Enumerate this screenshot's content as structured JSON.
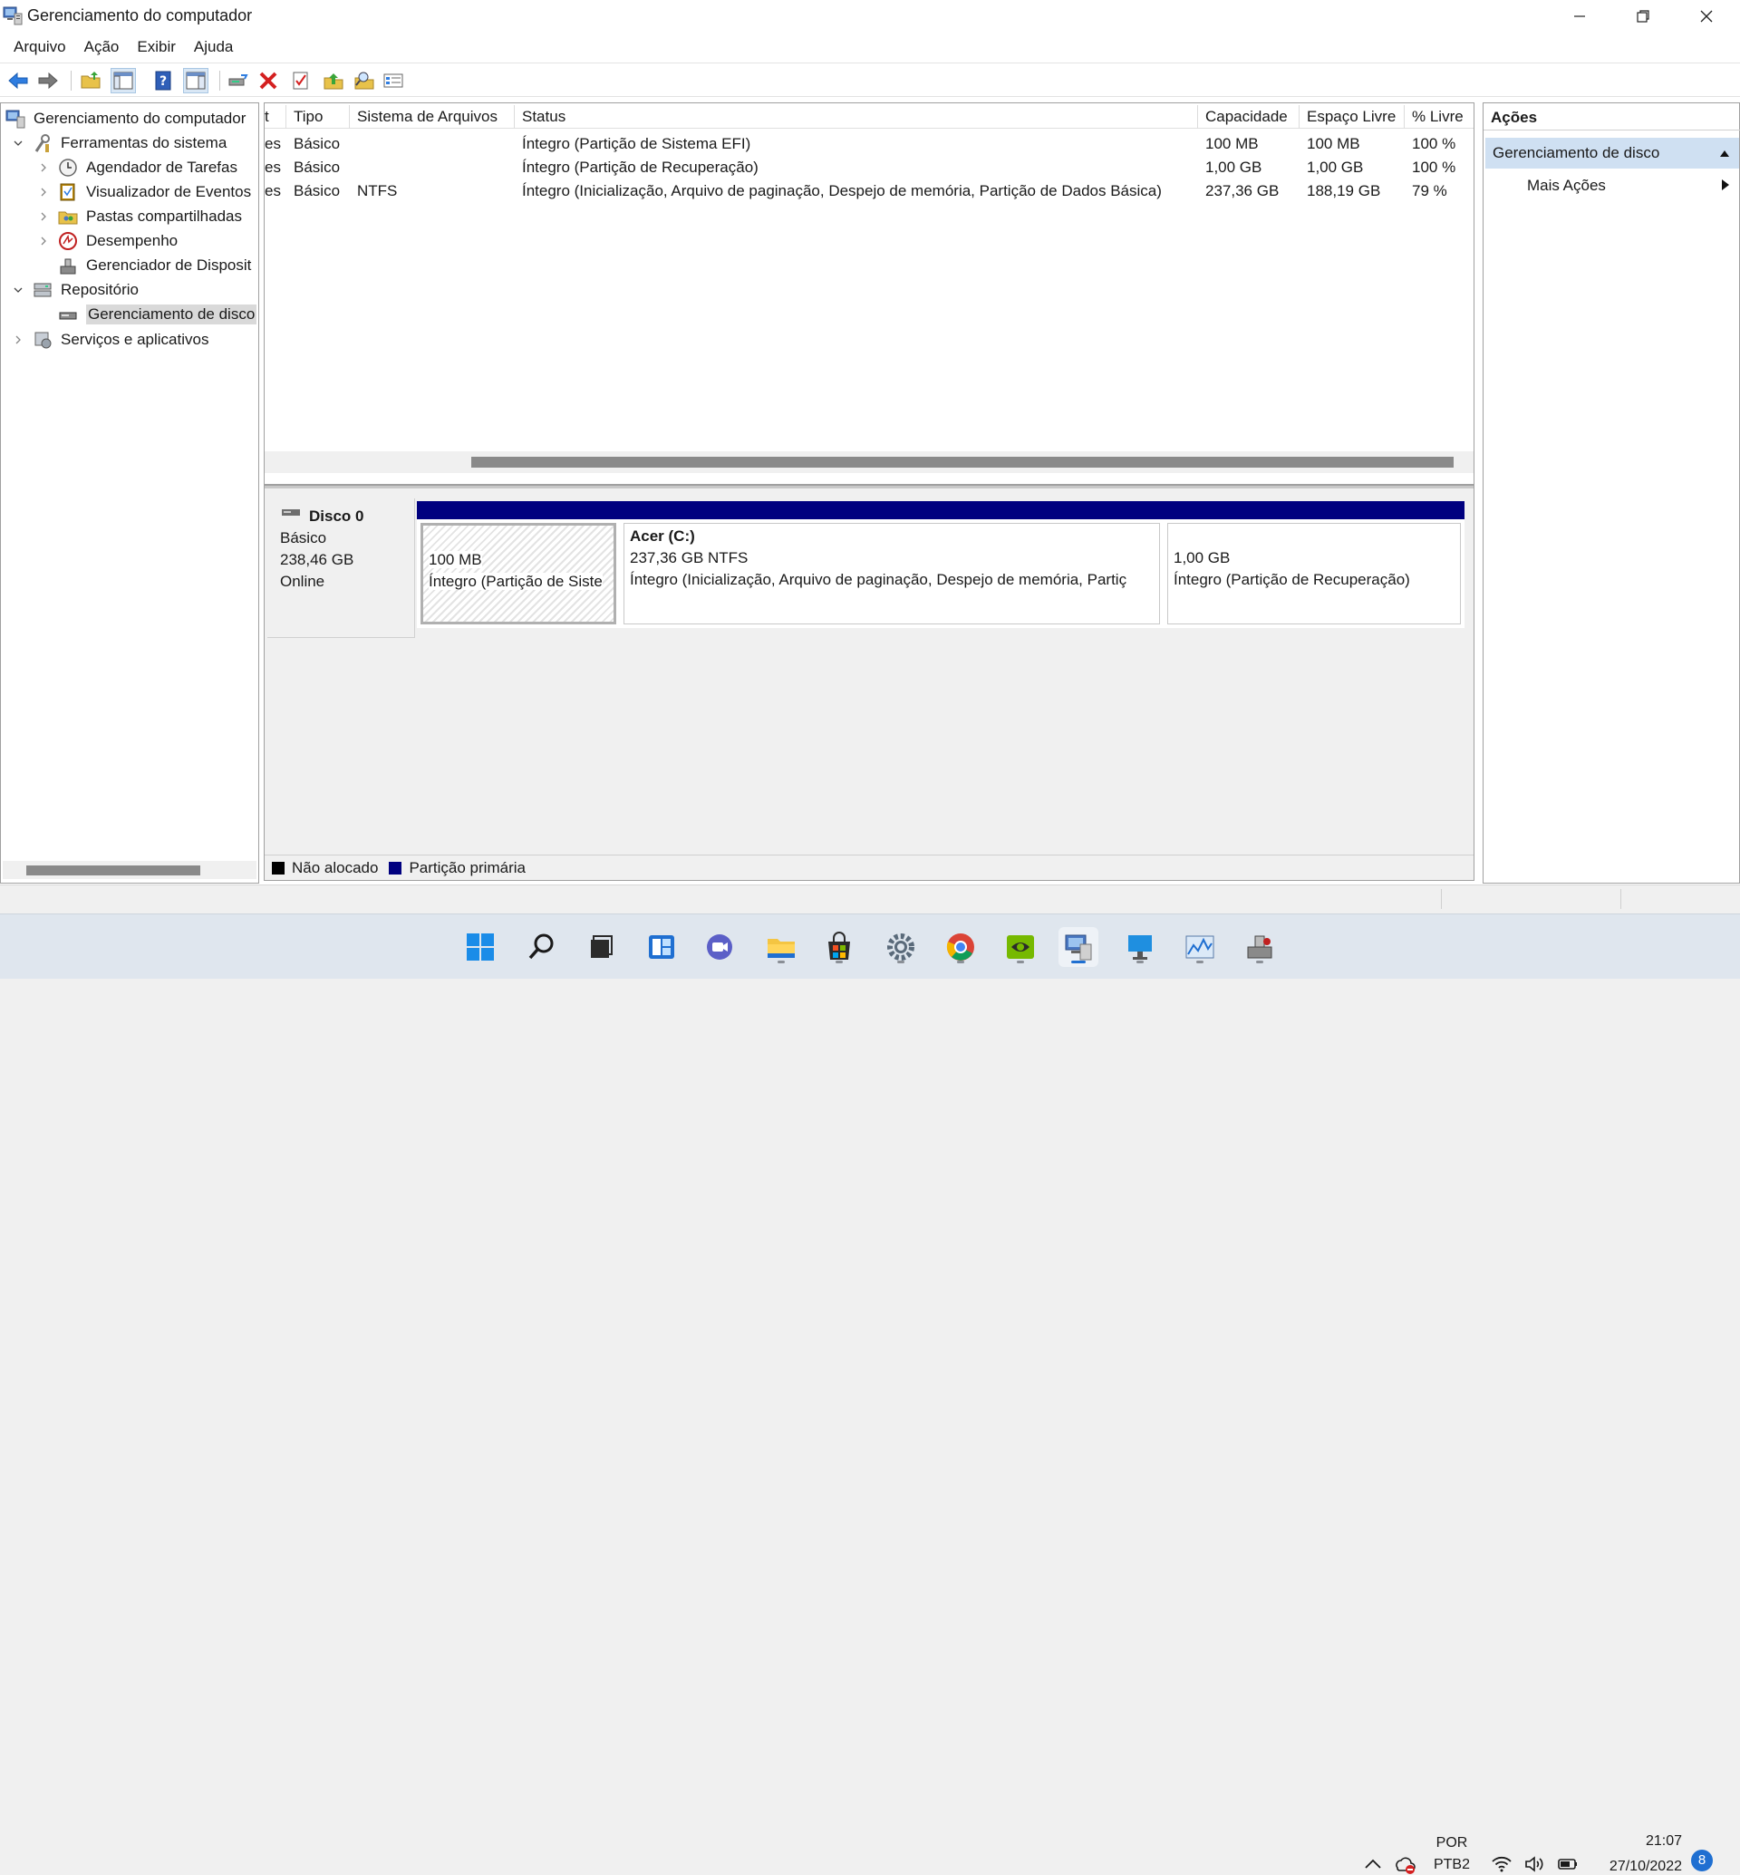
{
  "window": {
    "title": "Gerenciamento do computador"
  },
  "menu": [
    "Arquivo",
    "Ação",
    "Exibir",
    "Ajuda"
  ],
  "tree": {
    "root": "Gerenciamento do computador",
    "system_tools": "Ferramentas do sistema",
    "task_scheduler": "Agendador de Tarefas",
    "event_viewer": "Visualizador de Eventos",
    "shared_folders": "Pastas compartilhadas",
    "performance": "Desempenho",
    "device_manager": "Gerenciador de Disposit",
    "storage": "Repositório",
    "disk_management": "Gerenciamento de disco",
    "services": "Serviços e aplicativos"
  },
  "volumes": {
    "columns": [
      "t",
      "Tipo",
      "Sistema de Arquivos",
      "Status",
      "Capacidade",
      "Espaço Livre",
      "% Livre"
    ],
    "rows": [
      [
        "es",
        "Básico",
        "",
        "Íntegro (Partição de Sistema EFI)",
        "100 MB",
        "100 MB",
        "100 %"
      ],
      [
        "es",
        "Básico",
        "",
        "Íntegro (Partição de Recuperação)",
        "1,00 GB",
        "1,00 GB",
        "100 %"
      ],
      [
        "es",
        "Básico",
        "NTFS",
        "Íntegro (Inicialização, Arquivo de paginação, Despejo de memória, Partição de Dados Básica)",
        "237,36 GB",
        "188,19 GB",
        "79 %"
      ]
    ]
  },
  "disk": {
    "name": "Disco 0",
    "type": "Básico",
    "size": "238,46 GB",
    "state": "Online",
    "partitions": [
      {
        "title": "",
        "size": "100 MB",
        "status": "Íntegro (Partição de Siste"
      },
      {
        "title": "Acer  (C:)",
        "size": "237,36 GB NTFS",
        "status": "Íntegro (Inicialização, Arquivo de paginação, Despejo de memória, Partiç"
      },
      {
        "title": "",
        "size": "1,00 GB",
        "status": "Íntegro (Partição de Recuperação)"
      }
    ]
  },
  "legend": {
    "unallocated": "Não alocado",
    "primary": "Partição primária",
    "unallocated_color": "#000000",
    "primary_color": "#00007f"
  },
  "actions": {
    "title": "Ações",
    "section": "Gerenciamento de disco",
    "more": "Mais Ações"
  },
  "taskbar": {
    "lang1": "POR",
    "lang2": "PTB2",
    "time": "21:07",
    "date": "27/10/2022",
    "notifications": "8"
  }
}
